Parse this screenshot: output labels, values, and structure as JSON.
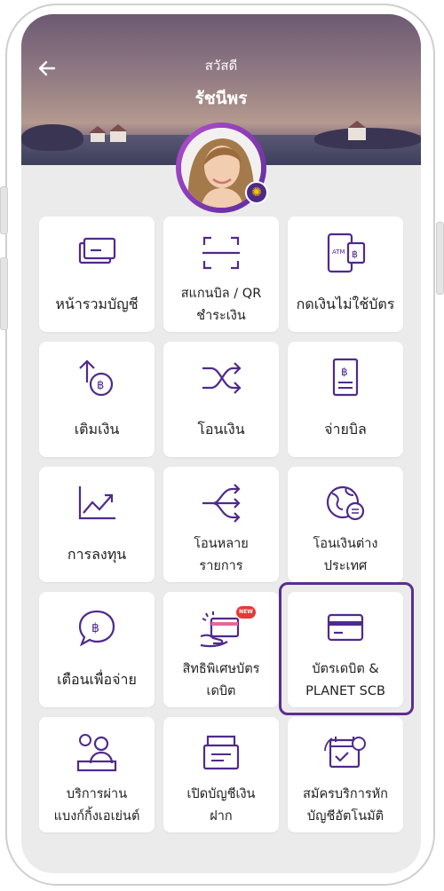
{
  "header": {
    "back_icon": "arrow-left-icon",
    "greeting": "สวัสดี",
    "user_name": "รัชนีพร"
  },
  "colors": {
    "accent": "#4f2a8c",
    "highlight": "#5b2e8f",
    "tile_bg": "#ffffff",
    "screen_bg": "#ebebeb",
    "text": "#1f1f1f"
  },
  "menu": {
    "items": [
      {
        "label": "หน้ารวมบัญชี",
        "icon": "account-card-icon"
      },
      {
        "label": "สแกนบิล / QR\nชำระเงิน",
        "icon": "scan-qr-icon"
      },
      {
        "label": "กดเงินไม่ใช้บัตร",
        "icon": "atm-cardless-icon"
      },
      {
        "label": "เติมเงิน",
        "icon": "top-up-icon"
      },
      {
        "label": "โอนเงิน",
        "icon": "transfer-icon"
      },
      {
        "label": "จ่ายบิล",
        "icon": "pay-bill-icon"
      },
      {
        "label": "การลงทุน",
        "icon": "investment-chart-icon"
      },
      {
        "label": "โอนหลาย\nรายการ",
        "icon": "multi-transfer-icon"
      },
      {
        "label": "โอนเงินต่าง\nประเทศ",
        "icon": "global-transfer-icon"
      },
      {
        "label": "เตือนเพื่อจ่าย",
        "icon": "payment-alert-icon"
      },
      {
        "label": "สิทธิพิเศษบัตร\nเดบิต",
        "icon": "debit-privilege-icon",
        "badge": "NEW"
      },
      {
        "label": "บัตรเดบิต &\nPLANET SCB",
        "icon": "debit-card-icon"
      },
      {
        "label": "บริการผ่าน\nแบงก์กิ้งเอเย่นต์",
        "icon": "banking-agent-icon"
      },
      {
        "label": "เปิดบัญชีเงิน\nฝาก",
        "icon": "open-deposit-icon"
      },
      {
        "label": "สมัครบริการหัก\nบัญชีอัตโนมัติ",
        "icon": "auto-debit-icon"
      }
    ]
  }
}
